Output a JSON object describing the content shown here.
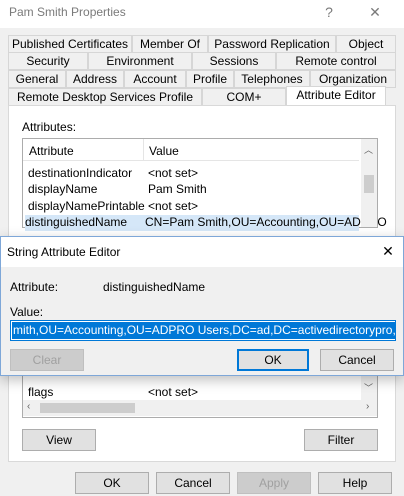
{
  "outer": {
    "title": "Pam Smith Properties",
    "help_glyph": "?",
    "close_glyph": "✕",
    "tabs_row1": [
      "Published Certificates",
      "Member Of",
      "Password Replication",
      "Object"
    ],
    "tabs_row2": [
      "Security",
      "Environment",
      "Sessions",
      "Remote control"
    ],
    "tabs_row3": [
      "General",
      "Address",
      "Account",
      "Profile",
      "Telephones",
      "Organization"
    ],
    "tabs_row4": [
      "Remote Desktop Services Profile",
      "COM+",
      "Attribute Editor"
    ],
    "attributes_label": "Attributes:",
    "list": {
      "headers": [
        "Attribute",
        "Value"
      ],
      "rows": [
        {
          "attribute": "destinationIndicator",
          "value": "<not set>"
        },
        {
          "attribute": "displayName",
          "value": "Pam Smith"
        },
        {
          "attribute": "displayNamePrintable",
          "value": "<not set>"
        },
        {
          "attribute": "distinguishedName",
          "value": "CN=Pam Smith,OU=Accounting,OU=ADPRO"
        }
      ],
      "lower_row": {
        "attribute": "flags",
        "value": "<not set>"
      }
    },
    "view_button": "View",
    "filter_button": "Filter",
    "ok_button": "OK",
    "cancel_button": "Cancel",
    "apply_button": "Apply",
    "help_button": "Help"
  },
  "dialog": {
    "title": "String Attribute Editor",
    "close_glyph": "✕",
    "attribute_label": "Attribute:",
    "attribute_value": "distinguishedName",
    "value_label": "Value:",
    "value_text": "mith,OU=Accounting,OU=ADPRO Users,DC=ad,DC=activedirectorypro,DC=com",
    "clear_button": "Clear",
    "ok_button": "OK",
    "cancel_button": "Cancel"
  }
}
